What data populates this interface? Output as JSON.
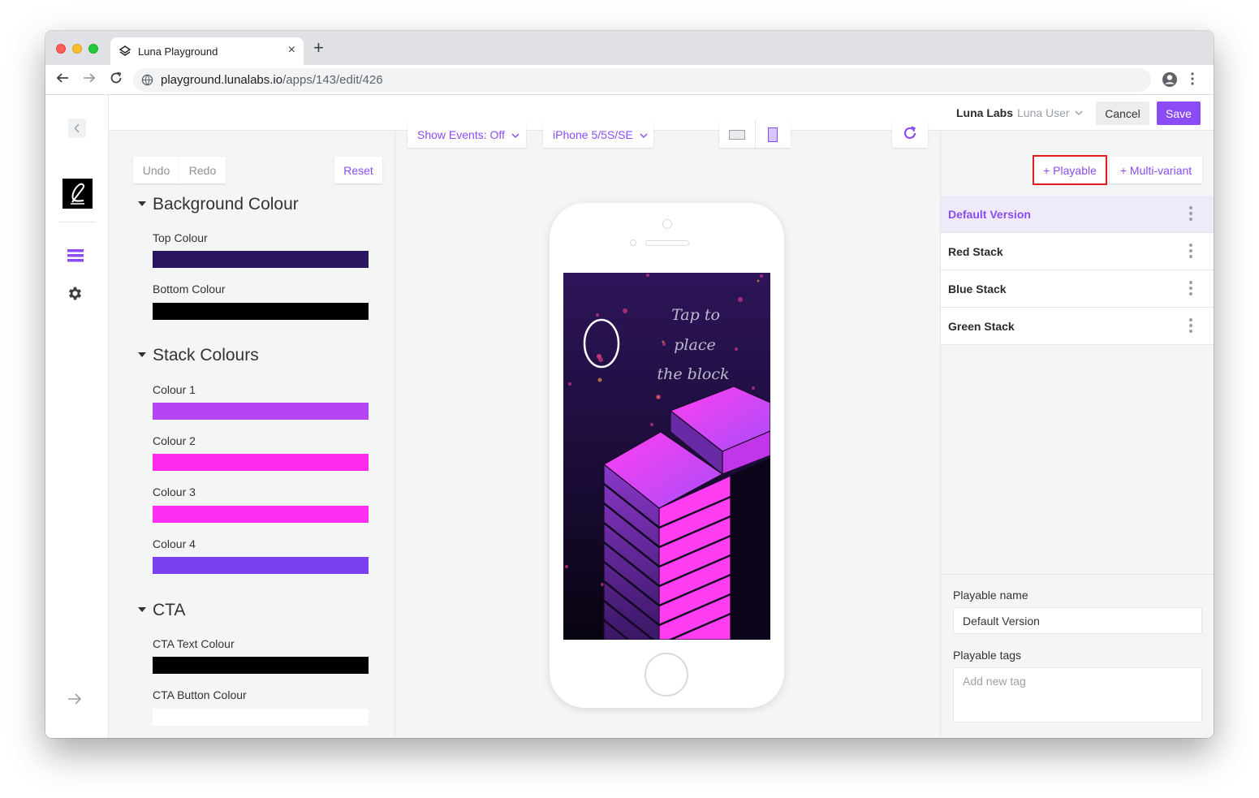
{
  "browser": {
    "tab_title": "Luna Playground",
    "tab_close": "×",
    "new_tab": "+",
    "url_host": "playground.lunalabs.io",
    "url_path": "/apps/143/edit/426"
  },
  "topbar": {
    "org": "Luna Labs",
    "user": "Luna User",
    "cancel_label": "Cancel",
    "save_label": "Save"
  },
  "settings": {
    "undo_label": "Undo",
    "redo_label": "Redo",
    "reset_label": "Reset",
    "sections": [
      {
        "title": "Background Colour",
        "fields": [
          {
            "label": "Top Colour",
            "color": "#2a1560"
          },
          {
            "label": "Bottom Colour",
            "color": "#000000"
          }
        ]
      },
      {
        "title": "Stack Colours",
        "fields": [
          {
            "label": "Colour 1",
            "color": "#b444f4"
          },
          {
            "label": "Colour 2",
            "color": "#ff2aee"
          },
          {
            "label": "Colour 3",
            "color": "#ff2ef2"
          },
          {
            "label": "Colour 4",
            "color": "#7b3ff2"
          }
        ]
      },
      {
        "title": "CTA",
        "fields": [
          {
            "label": "CTA Text Colour",
            "color": "#000000"
          },
          {
            "label": "CTA Button Colour",
            "color": "#ffffff"
          }
        ]
      }
    ]
  },
  "preview": {
    "show_events_label": "Show Events: Off",
    "device_label": "iPhone 5/5S/SE",
    "game_hint_lines": [
      "Tap to",
      "place",
      "the block"
    ]
  },
  "versions": {
    "add_playable_label": "+ Playable",
    "add_multivariant_label": "+ Multi-variant",
    "items": [
      {
        "name": "Default Version",
        "active": true
      },
      {
        "name": "Red Stack",
        "active": false
      },
      {
        "name": "Blue Stack",
        "active": false
      },
      {
        "name": "Green Stack",
        "active": false
      }
    ],
    "playable_name_label": "Playable name",
    "playable_name_value": "Default Version",
    "playable_tags_label": "Playable tags",
    "playable_tags_placeholder": "Add new tag"
  },
  "icons": {
    "back": "arrow-left-icon",
    "forward": "arrow-right-icon",
    "reload": "reload-icon",
    "site_info": "globe-icon",
    "profile": "account-circle-icon",
    "menu": "kebab-menu-icon",
    "collapse": "chevron-left-icon",
    "layers": "list-icon",
    "settings": "gear-icon",
    "expand": "arrow-right-icon"
  },
  "colors": {
    "accent": "#8b4cf6",
    "highlight_outline": "#e11d1d"
  }
}
